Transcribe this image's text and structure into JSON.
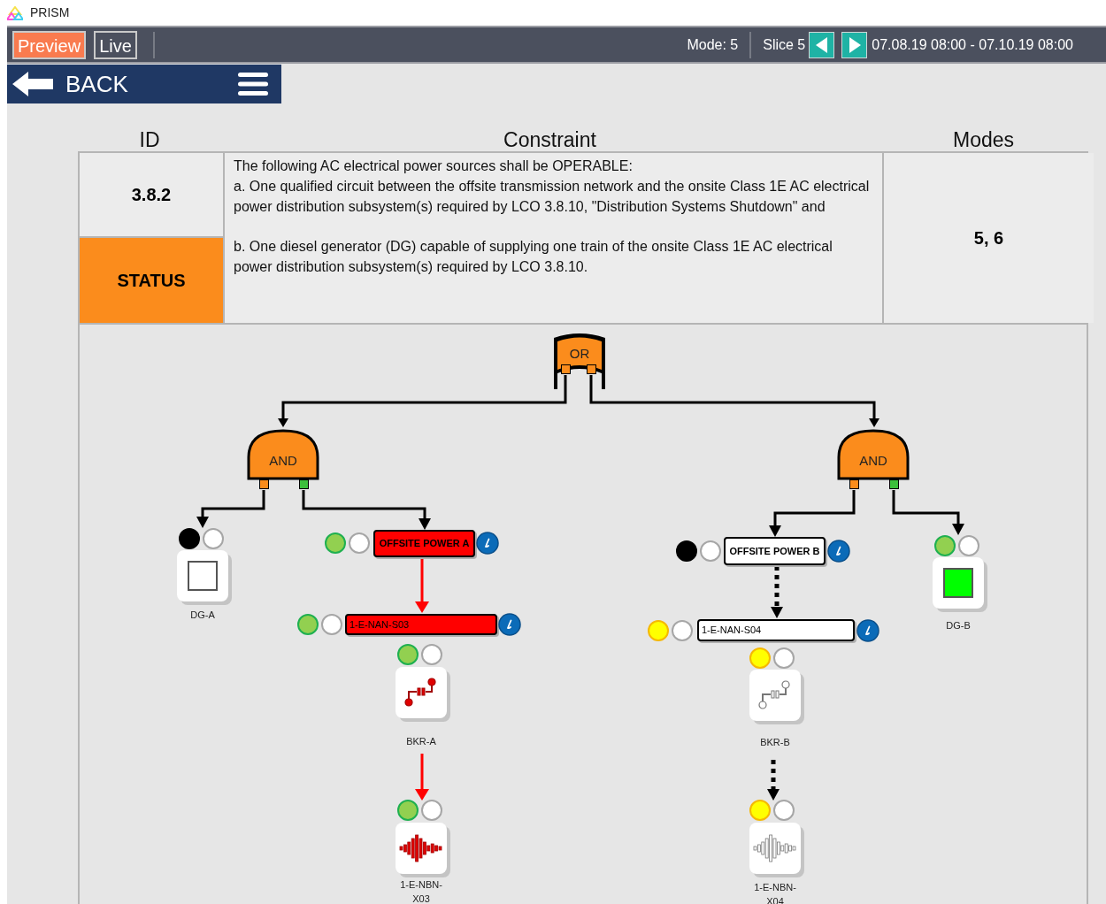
{
  "app": {
    "title": "PRISM"
  },
  "toolbar": {
    "tabs": [
      {
        "label": "Preview",
        "selected": true
      },
      {
        "label": "Live",
        "selected": false
      }
    ],
    "mode": "Mode: 5",
    "slice": "Slice 5",
    "range": "07.08.19 08:00 - 07.10.19 08:00"
  },
  "nav": {
    "back": "BACK"
  },
  "table": {
    "columns": [
      "ID",
      "Constraint",
      "Modes"
    ],
    "id": "3.8.2",
    "status": "STATUS",
    "constraint": [
      "The following AC electrical power sources shall be OPERABLE:",
      "a. One qualified circuit between the offsite transmission network and the onsite Class 1E AC electrical power distribution subsystem(s) required by LCO 3.8.10, \"Distribution Systems Shutdown\" and",
      "b. One diesel generator (DG) capable of supplying one train of the onsite Class 1E AC electrical power distribution subsystem(s) required by LCO 3.8.10."
    ],
    "modes": "5, 6"
  },
  "diagram": {
    "gates": [
      {
        "kind": "or",
        "label": "OR",
        "ports": [
          {
            "color": "#fb8c1c"
          },
          {
            "color": "#fb8c1c"
          }
        ]
      },
      {
        "kind": "and",
        "label": "AND",
        "ports": [
          {
            "color": "#fb8c1c"
          },
          {
            "color": "#3cc03c"
          }
        ]
      },
      {
        "kind": "and",
        "label": "AND",
        "ports": [
          {
            "color": "#fb8c1c"
          },
          {
            "color": "#3cc03c"
          }
        ]
      }
    ],
    "nodes": [
      {
        "kind": "generator",
        "label": "DG-A",
        "color": "#000000",
        "on": false,
        "link": {
          "kind": "plain"
        }
      },
      {
        "kind": "source",
        "label": "OFFSITE POWER A",
        "color": "#92d050",
        "alarm": true,
        "link": {
          "kind": "plain"
        }
      },
      {
        "kind": "feeder",
        "label": "1-E-NAN-S03",
        "color": "#92d050",
        "alarm": true,
        "link": {
          "kind": "alarm"
        }
      },
      {
        "kind": "breaker",
        "label": "BKR-A",
        "color": "#92d050",
        "alarm": true
      },
      {
        "kind": "load",
        "label": "1-E-NBN-X03",
        "color": "#92d050",
        "alarm": true,
        "link": {
          "kind": "alarm"
        }
      },
      {
        "kind": "source",
        "label": "OFFSITE POWER B",
        "color": "#000000",
        "alarm": false,
        "link": {
          "kind": "plain"
        }
      },
      {
        "kind": "feeder",
        "label": "1-E-NAN-S04",
        "color": "#ffff00",
        "alarm": false,
        "link": {
          "kind": "dotted"
        }
      },
      {
        "kind": "breaker",
        "label": "BKR-B",
        "color": "#ffff00",
        "alarm": false
      },
      {
        "kind": "load",
        "label": "1-E-NBN-X04",
        "color": "#ffff00",
        "alarm": false,
        "link": {
          "kind": "dotted"
        }
      },
      {
        "kind": "generator",
        "label": "DG-B",
        "color": "#92d050",
        "on": true,
        "link": {
          "kind": "plain"
        }
      }
    ]
  }
}
